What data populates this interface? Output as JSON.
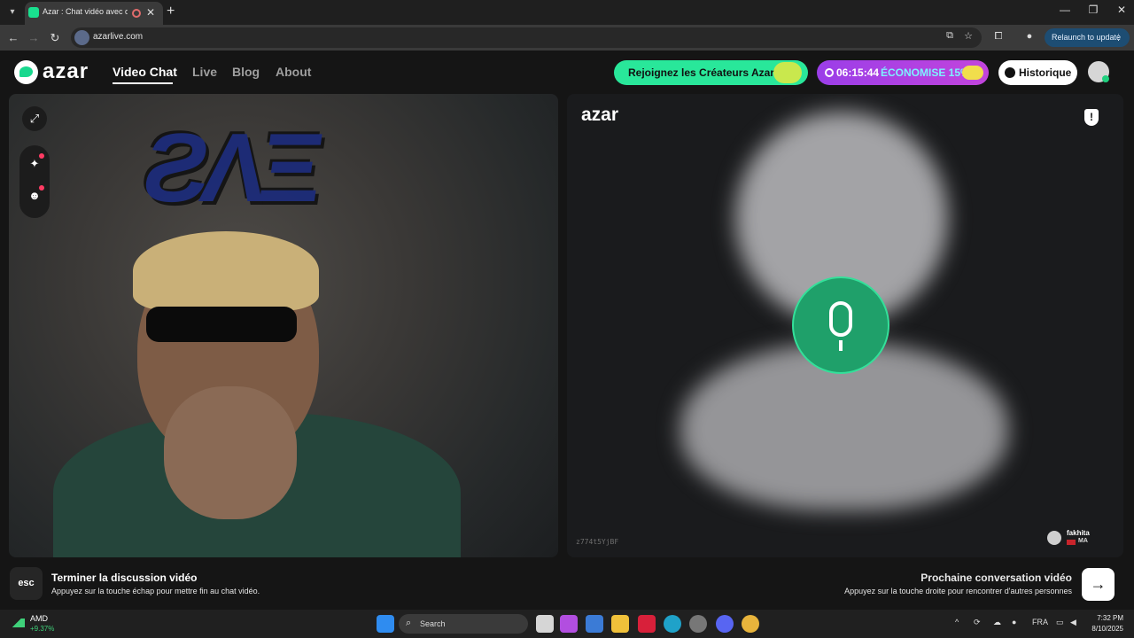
{
  "browser": {
    "tab_title": "Azar : Chat vidéo avec de n",
    "url": "azarlive.com",
    "relaunch_label": "Relaunch to update"
  },
  "header": {
    "logo_text": "azar",
    "nav": [
      "Video Chat",
      "Live",
      "Blog",
      "About"
    ],
    "creators_label": "Rejoignez les Créateurs Azar",
    "promo_timer": "06:15:44",
    "promo_label": "ÉCONOMISE 15%",
    "history_label": "Historique"
  },
  "remote": {
    "logo_text": "azar",
    "partner_id": "z774t5YjBF",
    "user_name": "fakhita",
    "user_country": "MA"
  },
  "footer": {
    "esc_key": "esc",
    "end_title": "Terminer la discussion vidéo",
    "end_subtitle": "Appuyez sur la touche échap pour mettre fin au chat vidéo.",
    "next_title": "Prochaine conversation vidéo",
    "next_subtitle": "Appuyez sur la touche droite pour rencontrer d'autres personnes"
  },
  "taskbar": {
    "stock_name": "AMD",
    "stock_delta": "+9.37%",
    "search_label": "Search",
    "language": "FRA",
    "time": "7:32 PM",
    "date": "8/10/2025"
  },
  "colors": {
    "brand_green": "#29e79a",
    "promo_purple": "#9b3ee8",
    "relaunch_blue": "#1d4d73"
  }
}
